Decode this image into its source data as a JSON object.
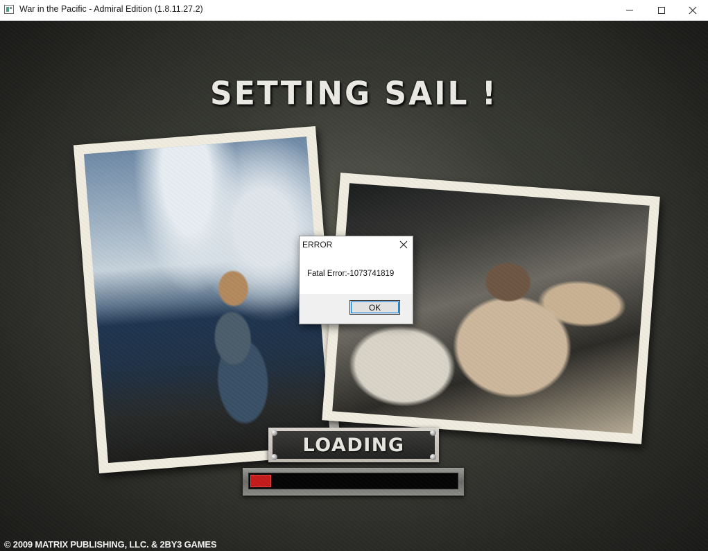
{
  "window": {
    "title": "War in the Pacific - Admiral Edition (1.8.11.27.2)",
    "controls": [
      "minimize-icon",
      "maximize-icon",
      "close-icon"
    ]
  },
  "screen": {
    "title": "SETTING SAIL !",
    "loading_label": "LOADING",
    "progress_fraction": 0.1,
    "copyright": "© 2009 MATRIX PUBLISHING, LLC. & 2BY3 GAMES"
  },
  "dialog": {
    "title": "ERROR",
    "message": "Fatal Error:-1073741819",
    "ok_label": "OK"
  },
  "colors": {
    "progress_fill": "#c41b1b",
    "focus_outline": "#0078d7"
  }
}
